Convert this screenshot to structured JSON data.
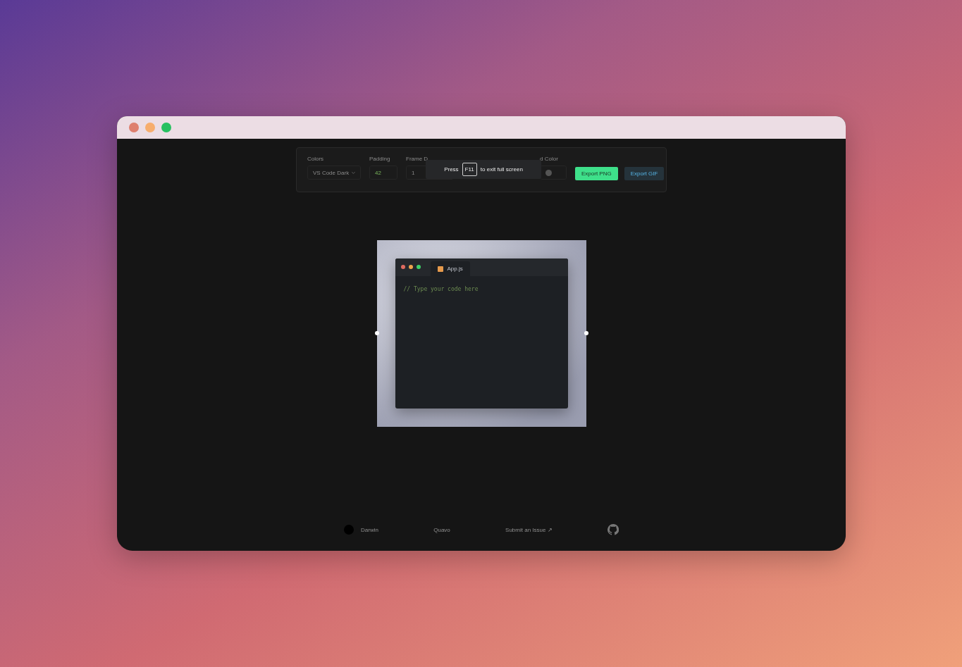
{
  "toolbar": {
    "colors": {
      "label": "Colors",
      "value": "VS Code Dark"
    },
    "padding": {
      "label": "Padding",
      "value": "42"
    },
    "frame_duration": {
      "label": "Frame D",
      "value": "1"
    },
    "background_color": {
      "label": "d Color"
    },
    "buttons": [
      {
        "label": "Export PNG",
        "kind": "primary"
      },
      {
        "label": "Export GIF",
        "kind": "secondary"
      }
    ]
  },
  "toast": {
    "before": "Press",
    "key": "F11",
    "after": "to exit full screen"
  },
  "editor": {
    "tab": "App.js",
    "code": "// Type your code here"
  },
  "footer": {
    "links": [
      {
        "label": "Darwin"
      },
      {
        "label": "Quavo"
      },
      {
        "label": "Submit an Issue ↗"
      }
    ]
  }
}
